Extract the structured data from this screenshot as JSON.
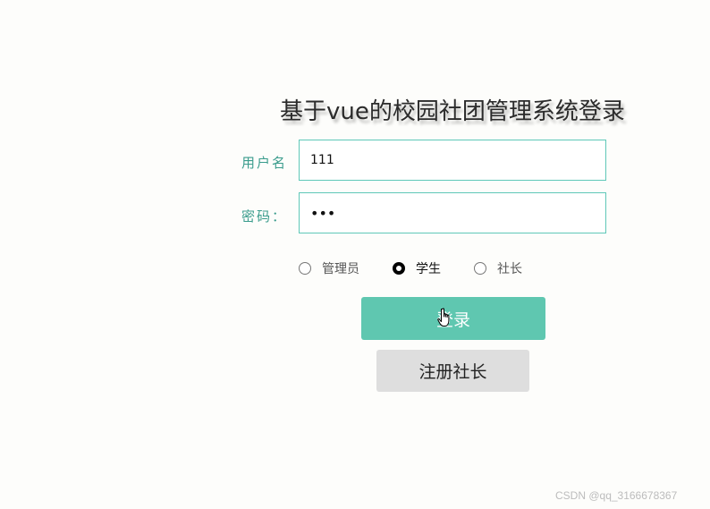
{
  "title": "基于vue的校园社团管理系统登录",
  "form": {
    "username_label": "用户名",
    "username_value": "111",
    "password_label": "密码：",
    "password_value": "111"
  },
  "roles": {
    "options": [
      "管理员",
      "学生",
      "社长"
    ],
    "selected": "学生"
  },
  "buttons": {
    "login": "登录",
    "register": "注册社长"
  },
  "colors": {
    "accent": "#5fc7b0",
    "label": "#3a9c8c",
    "input_border": "#5fc8b8",
    "secondary_button": "#dedede"
  },
  "icons": {
    "cursor": "hand-pointer-icon"
  },
  "watermark": "CSDN @qq_3166678367"
}
